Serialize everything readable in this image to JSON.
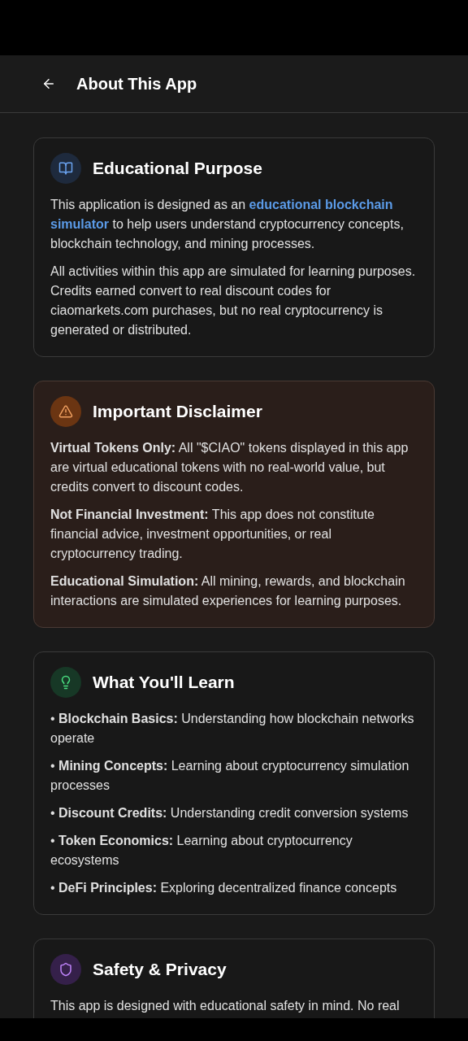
{
  "header": {
    "title": "About This App"
  },
  "cards": [
    {
      "kind": "book",
      "title": "Educational Purpose",
      "paragraphs": [
        {
          "parts": [
            {
              "kind": "text",
              "text": "This application is designed as an"
            },
            {
              "kind": "link",
              "text": "educational blockchain"
            },
            {
              "kind": "link",
              "text": "simulator"
            },
            {
              "kind": "text",
              "text": "to help users understand cryptocurrency concepts, blockchain technology, and mining processes."
            }
          ]
        },
        {
          "parts": [
            {
              "kind": "text",
              "text": "All activities within this app are simulated for learning purposes. Credits earned convert to real discount codes for ciaomarkets.com purchases, but no real cryptocurrency is generated or distributed."
            }
          ]
        }
      ]
    },
    {
      "kind": "warning",
      "title": "Important Disclaimer",
      "paragraphs": [
        {
          "parts": [
            {
              "kind": "text",
              "text": "**Virtual Tokens Only:** All \"$CIAO\" tokens displayed in this app are virtual educational tokens with no real-world value, but credits convert to discount codes."
            }
          ]
        },
        {
          "parts": [
            {
              "kind": "text",
              "text": "**Not Financial Investment:** This app does not constitute financial advice, investment opportunities, or real cryptocurrency trading."
            }
          ]
        },
        {
          "parts": [
            {
              "kind": "text",
              "text": "**Educational Simulation:** All mining, rewards, and blockchain interactions are simulated experiences for learning purposes."
            }
          ]
        }
      ]
    },
    {
      "kind": "bulb",
      "title": "What You'll Learn",
      "paragraphs": [
        {
          "parts": [
            {
              "kind": "text",
              "text": "• **Blockchain Basics:** Understanding how blockchain networks operate"
            }
          ]
        },
        {
          "parts": [
            {
              "kind": "text",
              "text": "• **Mining Concepts:** Learning about cryptocurrency simulation processes"
            }
          ]
        },
        {
          "parts": [
            {
              "kind": "text",
              "text": "• **Discount Credits:** Understanding credit conversion systems"
            }
          ]
        },
        {
          "parts": [
            {
              "kind": "text",
              "text": "• **Token Economics:** Learning about cryptocurrency ecosystems"
            }
          ]
        },
        {
          "parts": [
            {
              "kind": "text",
              "text": "• **DeFi Principles:** Exploring decentralized finance concepts"
            }
          ]
        }
      ]
    },
    {
      "kind": "shield",
      "title": "Safety & Privacy",
      "paragraphs": [
        {
          "parts": [
            {
              "kind": "text",
              "text": "This app is designed with educational safety in mind. No real"
            }
          ]
        }
      ]
    }
  ]
}
